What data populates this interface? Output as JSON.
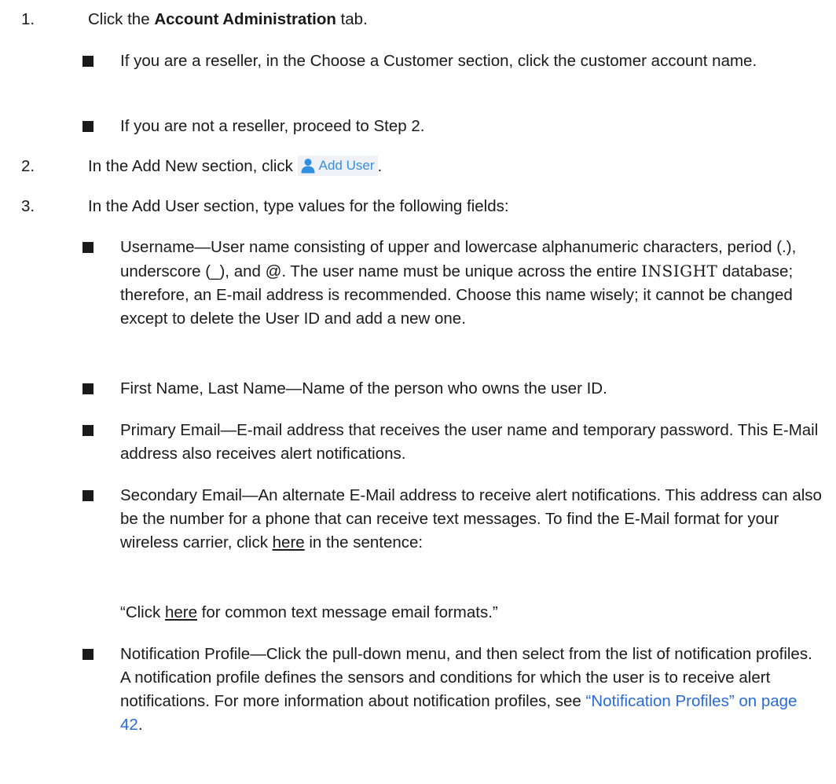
{
  "steps": [
    {
      "num": "1.",
      "pre": "Click the ",
      "bold": "Account Administration",
      "post": " tab."
    },
    {
      "num": "2.",
      "pre": "In the Add New section, click ",
      "button": "Add User",
      "post": "."
    },
    {
      "num": "3.",
      "text": "In the Add User section, type values for the following fields:"
    }
  ],
  "step1_bullets": [
    "If you are a reseller, in the Choose a Customer section, click the customer account name.",
    "If you are not a reseller, proceed to Step 2."
  ],
  "fields": {
    "username": {
      "pre": "Username—User name consisting of upper and lowercase alphanumeric characters, period (.), underscore (_), and @. The user name must be unique across the entire ",
      "brand": "INSIGHT",
      "post": " database; therefore, an E-mail address is recommended. Choose this name wisely; it cannot be changed except to delete the User ID and add a new one."
    },
    "names": "First Name, Last Name—Name of the person who owns the user ID.",
    "primary_email": "Primary Email—E-mail address that receives the user name and temporary password. This E-Mail address also receives alert notifications.",
    "secondary_email": {
      "pre": "Secondary Email—An alternate E-Mail address to receive alert notifications. This address can also be the number for a phone that can receive text messages. To find the E-Mail format for your wireless carrier, click ",
      "link": "here",
      "post": " in the sentence:"
    },
    "quote": {
      "pre": "“Click ",
      "link": "here",
      "post": " for common text message email formats.”"
    },
    "notification_profile": {
      "pre": "Notification Profile—Click the pull-down menu, and then select from the list of notification profiles. A notification profile defines the sensors and conditions for which the user is to receive alert notifications. For more information about notification profiles, see ",
      "xref": "“Notification Profiles” on page 42",
      "post": "."
    }
  },
  "colors": {
    "link": "#2a6bd8",
    "button_text": "#3a8fd8",
    "button_bg": "#eef1f5",
    "user_icon": "#2f8fe0"
  },
  "icons": {
    "add_user": "user-icon",
    "bullet": "square-bullet"
  }
}
